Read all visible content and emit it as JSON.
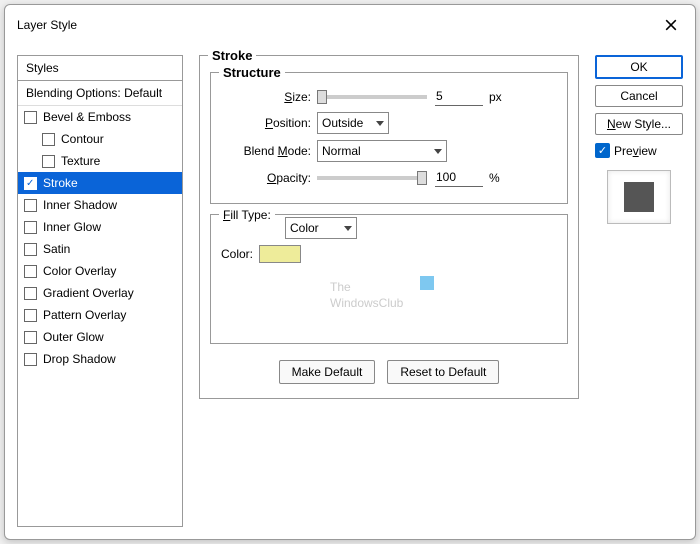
{
  "title": "Layer Style",
  "styles": {
    "header": "Styles",
    "blending": "Blending Options: Default",
    "items": [
      {
        "label": "Bevel & Emboss",
        "checked": false,
        "indent": false,
        "selected": false
      },
      {
        "label": "Contour",
        "checked": false,
        "indent": true,
        "selected": false
      },
      {
        "label": "Texture",
        "checked": false,
        "indent": true,
        "selected": false
      },
      {
        "label": "Stroke",
        "checked": true,
        "indent": false,
        "selected": true
      },
      {
        "label": "Inner Shadow",
        "checked": false,
        "indent": false,
        "selected": false
      },
      {
        "label": "Inner Glow",
        "checked": false,
        "indent": false,
        "selected": false
      },
      {
        "label": "Satin",
        "checked": false,
        "indent": false,
        "selected": false
      },
      {
        "label": "Color Overlay",
        "checked": false,
        "indent": false,
        "selected": false
      },
      {
        "label": "Gradient Overlay",
        "checked": false,
        "indent": false,
        "selected": false
      },
      {
        "label": "Pattern Overlay",
        "checked": false,
        "indent": false,
        "selected": false
      },
      {
        "label": "Outer Glow",
        "checked": false,
        "indent": false,
        "selected": false
      },
      {
        "label": "Drop Shadow",
        "checked": false,
        "indent": false,
        "selected": false
      }
    ]
  },
  "stroke": {
    "title": "Stroke",
    "structure": {
      "title": "Structure",
      "size": {
        "label": "Size:",
        "value": "5",
        "unit": "px"
      },
      "position": {
        "label": "Position:",
        "value": "Outside"
      },
      "blend": {
        "label": "Blend Mode:",
        "value": "Normal"
      },
      "opacity": {
        "label": "Opacity:",
        "value": "100",
        "unit": "%"
      }
    },
    "fill": {
      "label": "Fill Type:",
      "value": "Color",
      "color_label": "Color:",
      "color": "#eeec9a"
    },
    "defaults": {
      "make": "Make Default",
      "reset": "Reset to Default"
    }
  },
  "side": {
    "ok": "OK",
    "cancel": "Cancel",
    "newstyle": "New Style...",
    "preview": "Preview"
  },
  "watermark": {
    "line1": "The",
    "line2": "WindowsClub"
  }
}
